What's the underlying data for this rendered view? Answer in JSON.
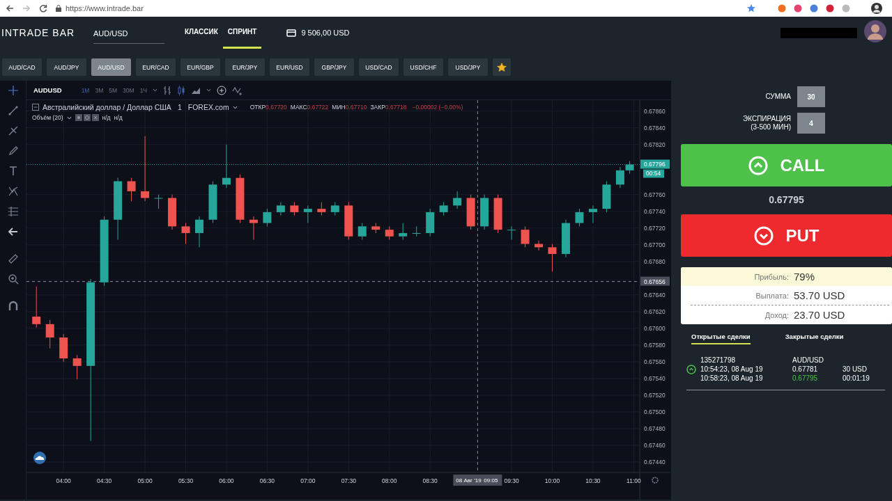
{
  "browser": {
    "url": "https://www.intrade.bar"
  },
  "header": {
    "logo": "INTRADE BAR",
    "asset": "AUD/USD",
    "modes": [
      {
        "label": "КЛАССИК",
        "selected": false
      },
      {
        "label": "СПРИНТ",
        "selected": true
      }
    ],
    "balance": "9 506,00 USD"
  },
  "pairs": [
    {
      "label": "AUD/CAD",
      "selected": false
    },
    {
      "label": "AUD/JPY",
      "selected": false
    },
    {
      "label": "AUD/USD",
      "selected": true
    },
    {
      "label": "EUR/CAD",
      "selected": false
    },
    {
      "label": "EUR/GBP",
      "selected": false
    },
    {
      "label": "EUR/JPY",
      "selected": false
    },
    {
      "label": "EUR/USD",
      "selected": false
    },
    {
      "label": "GBP/JPY",
      "selected": false
    },
    {
      "label": "USD/CAD",
      "selected": false
    },
    {
      "label": "USD/CHF",
      "selected": false
    },
    {
      "label": "USD/JPY",
      "selected": false
    }
  ],
  "chart": {
    "symbol": "AUDUSD",
    "intervals": [
      {
        "label": "1М",
        "selected": true
      },
      {
        "label": "3М",
        "selected": false
      },
      {
        "label": "5М",
        "selected": false
      },
      {
        "label": "30М",
        "selected": false
      },
      {
        "label": "1Ч",
        "selected": false
      }
    ],
    "legend": {
      "title": "Австралийский доллар / Доллар США",
      "interval": "1",
      "source": "FOREX.com",
      "fields": [
        {
          "label": "ОТКР",
          "value": "0.67720"
        },
        {
          "label": "МАКС",
          "value": "0.67722"
        },
        {
          "label": "МИН",
          "value": "0.67710"
        },
        {
          "label": "ЗАКР",
          "value": "0.67718"
        }
      ],
      "change": "−0.00002 (−0.00%)",
      "volume": "Объём (20)",
      "volume_values": [
        "н/д",
        "н/д"
      ]
    },
    "price_tag": "0.67796",
    "countdown": "00:54",
    "crosshair": {
      "price": "0.67656",
      "date": "08 Авг '19",
      "time": "09:05"
    },
    "chart_data": {
      "type": "candlestick",
      "grid": true,
      "xlim": [
        212.7,
        687
      ],
      "ylim": [
        0.67395,
        0.67873
      ],
      "ref_lines": [
        {
          "axis": "y",
          "value": 0.67796,
          "color": "#26a69a"
        },
        {
          "axis": "y",
          "value": 0.67656,
          "color": "#8a8e99"
        },
        {
          "axis": "x",
          "value": 545,
          "color": "#8a8e99"
        }
      ],
      "x": [
        220,
        230,
        240,
        250,
        260,
        270,
        280,
        290,
        300,
        310,
        320,
        330,
        340,
        350,
        360,
        370,
        380,
        390,
        400,
        410,
        420,
        430,
        440,
        450,
        460,
        470,
        480,
        490,
        500,
        510,
        520,
        530,
        540,
        550,
        560,
        570,
        580,
        590,
        600,
        610,
        620,
        630,
        640,
        650,
        657
      ],
      "ohlc": [
        [
          0.67614,
          0.6765,
          0.67601,
          0.67605
        ],
        [
          0.67605,
          0.6761,
          0.67576,
          0.67589
        ],
        [
          0.67589,
          0.67593,
          0.6756,
          0.67564
        ],
        [
          0.67564,
          0.67568,
          0.67539,
          0.67555
        ],
        [
          0.67555,
          0.67659,
          0.67465,
          0.67655
        ],
        [
          0.67655,
          0.67734,
          0.67651,
          0.6773
        ],
        [
          0.6773,
          0.6778,
          0.67706,
          0.67776
        ],
        [
          0.67776,
          0.6778,
          0.67752,
          0.67764
        ],
        [
          0.67764,
          0.6783,
          0.67752,
          0.67756
        ],
        [
          0.67756,
          0.6776,
          0.67743,
          0.67756
        ],
        [
          0.67756,
          0.6776,
          0.67718,
          0.67722
        ],
        [
          0.67722,
          0.67726,
          0.67701,
          0.67714
        ],
        [
          0.67714,
          0.67734,
          0.67697,
          0.6773
        ],
        [
          0.6773,
          0.67776,
          0.67726,
          0.67772
        ],
        [
          0.67772,
          0.6782,
          0.67768,
          0.6778
        ],
        [
          0.6778,
          0.67784,
          0.67726,
          0.6773
        ],
        [
          0.6773,
          0.67734,
          0.67706,
          0.67726
        ],
        [
          0.67726,
          0.67743,
          0.67722,
          0.67739
        ],
        [
          0.67739,
          0.67751,
          0.67735,
          0.67747
        ],
        [
          0.67747,
          0.67751,
          0.67735,
          0.67739
        ],
        [
          0.67739,
          0.67747,
          0.67726,
          0.67743
        ],
        [
          0.67743,
          0.67751,
          0.67735,
          0.67739
        ],
        [
          0.67739,
          0.67751,
          0.67735,
          0.67747
        ],
        [
          0.67747,
          0.67751,
          0.67706,
          0.6771
        ],
        [
          0.6771,
          0.67726,
          0.67706,
          0.67722
        ],
        [
          0.67722,
          0.67726,
          0.67714,
          0.67718
        ],
        [
          0.67718,
          0.67722,
          0.67706,
          0.6771
        ],
        [
          0.6771,
          0.67726,
          0.67706,
          0.67714
        ],
        [
          0.67714,
          0.67722,
          0.6771,
          0.67714
        ],
        [
          0.67714,
          0.67743,
          0.6771,
          0.67739
        ],
        [
          0.67739,
          0.67751,
          0.67735,
          0.67747
        ],
        [
          0.67747,
          0.67764,
          0.67743,
          0.67756
        ],
        [
          0.67756,
          0.6776,
          0.67718,
          0.67722
        ],
        [
          0.67722,
          0.6776,
          0.67718,
          0.67756
        ],
        [
          0.67756,
          0.6776,
          0.67714,
          0.67718
        ],
        [
          0.67718,
          0.67722,
          0.67706,
          0.67718
        ],
        [
          0.67718,
          0.67722,
          0.67697,
          0.67701
        ],
        [
          0.67701,
          0.67705,
          0.67693,
          0.67697
        ],
        [
          0.67697,
          0.67701,
          0.67668,
          0.67689
        ],
        [
          0.67689,
          0.6773,
          0.67685,
          0.67726
        ],
        [
          0.67726,
          0.67743,
          0.67722,
          0.67739
        ],
        [
          0.67739,
          0.67747,
          0.67726,
          0.67743
        ],
        [
          0.67743,
          0.67776,
          0.67739,
          0.67772
        ],
        [
          0.67772,
          0.67793,
          0.67768,
          0.67789
        ],
        [
          0.67789,
          0.678,
          0.67785,
          0.67796
        ]
      ],
      "xticks": [
        {
          "value": 240,
          "label": "04:00"
        },
        {
          "value": 270,
          "label": "04:30"
        },
        {
          "value": 300,
          "label": "05:00"
        },
        {
          "value": 330,
          "label": "05:30"
        },
        {
          "value": 360,
          "label": "06:00"
        },
        {
          "value": 390,
          "label": "06:30"
        },
        {
          "value": 420,
          "label": "07:00"
        },
        {
          "value": 450,
          "label": "07:30"
        },
        {
          "value": 480,
          "label": "08:00"
        },
        {
          "value": 510,
          "label": "08:30"
        },
        {
          "value": 570,
          "label": "09:30"
        },
        {
          "value": 600,
          "label": "10:00"
        },
        {
          "value": 630,
          "label": "10:30"
        },
        {
          "value": 660,
          "label": "11:00"
        }
      ],
      "yticks": [
        {
          "value": 0.6786,
          "label": "0.67860"
        },
        {
          "value": 0.6784,
          "label": "0.67840"
        },
        {
          "value": 0.6782,
          "label": "0.67820"
        },
        {
          "value": 0.6776,
          "label": "0.67760"
        },
        {
          "value": 0.6774,
          "label": "0.67740"
        },
        {
          "value": 0.6772,
          "label": "0.67720"
        },
        {
          "value": 0.677,
          "label": "0.67700"
        },
        {
          "value": 0.6768,
          "label": "0.67680"
        },
        {
          "value": 0.6764,
          "label": "0.67640"
        },
        {
          "value": 0.6762,
          "label": "0.67620"
        },
        {
          "value": 0.676,
          "label": "0.67600"
        },
        {
          "value": 0.6758,
          "label": "0.67580"
        },
        {
          "value": 0.6756,
          "label": "0.67560"
        },
        {
          "value": 0.6754,
          "label": "0.67540"
        },
        {
          "value": 0.6752,
          "label": "0.67520"
        },
        {
          "value": 0.675,
          "label": "0.67500"
        },
        {
          "value": 0.6748,
          "label": "0.67480"
        },
        {
          "value": 0.6746,
          "label": "0.67460"
        },
        {
          "value": 0.6744,
          "label": "0.67440"
        }
      ]
    }
  },
  "trade": {
    "amount_label": "СУММА",
    "amount": "30",
    "expiry_label": "ЭКСПИРАЦИЯ",
    "expiry_hint": "(3-500 МИН)",
    "expiry": "4",
    "call": "CALL",
    "price": "0.67795",
    "put": "PUT",
    "stats": [
      {
        "label": "Прибыль:",
        "value": "79%",
        "highlight": true
      },
      {
        "label": "Выплата:",
        "value": "53.70 USD",
        "highlight": false
      },
      {
        "label": "Доход:",
        "value": "23.70 USD",
        "highlight": false
      }
    ],
    "tabs": [
      {
        "label": "Открытые сделки",
        "selected": true
      },
      {
        "label": "Закрытые сделки",
        "selected": false
      }
    ],
    "deals": [
      {
        "id": "135271798",
        "open_time": "10:54:23, 08 Aug 19",
        "close_time": "10:58:23, 08 Aug 19",
        "asset": "AUD/USD",
        "open_price": "0.67781",
        "current_price": "0.67795",
        "amount": "30 USD",
        "remaining": "00:01:19"
      }
    ]
  }
}
